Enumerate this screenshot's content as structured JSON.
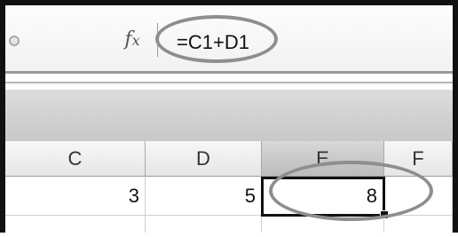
{
  "formula_bar": {
    "fx_label": "fx",
    "formula": "=C1+D1"
  },
  "columns": [
    "C",
    "D",
    "E",
    "F"
  ],
  "row1": {
    "C": "3",
    "D": "5",
    "E": "8",
    "F": ""
  },
  "active_cell_column": "E",
  "colors": {
    "annotation_ellipse": "#8e8e8e",
    "active_cell_border": "#111111"
  }
}
